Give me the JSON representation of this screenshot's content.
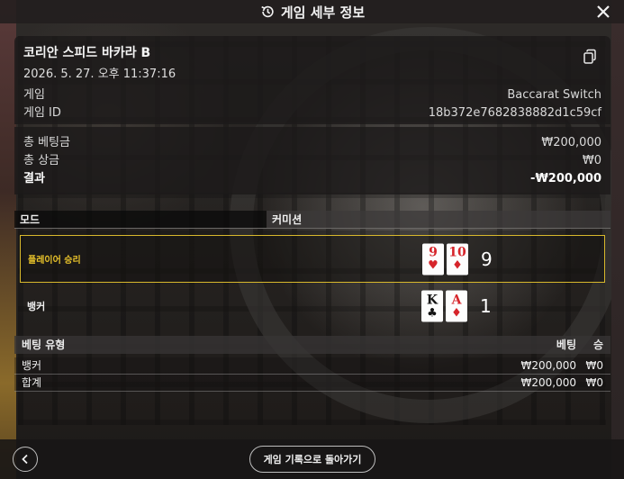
{
  "header": {
    "title": "게임 세부 정보"
  },
  "game": {
    "table_name": "코리안 스피드 바카라 B",
    "datetime": "2026. 5. 27. 오후 11:37:16",
    "game_label": "게임",
    "game_value": "Baccarat Switch",
    "game_id_label": "게임 ID",
    "game_id_value": "18b372e7682838882d1c59cf"
  },
  "totals": {
    "total_bet_label": "총 베팅금",
    "total_bet_value": "₩200,000",
    "total_win_label": "총 상금",
    "total_win_value": "₩0",
    "result_label": "결과",
    "result_value": "-₩200,000"
  },
  "mode": {
    "mode_label": "모드",
    "mode_value": "커미션"
  },
  "outcomes": {
    "player": {
      "label": "플레이어 승리",
      "score": "9",
      "cards": [
        {
          "rank": "9",
          "suit": "♥"
        },
        {
          "rank": "10",
          "suit": "♦"
        }
      ]
    },
    "banker": {
      "label": "뱅커",
      "score": "1",
      "cards": [
        {
          "rank": "K",
          "suit": "♣"
        },
        {
          "rank": "A",
          "suit": "♦"
        }
      ]
    }
  },
  "bets": {
    "headers": {
      "type": "베팅 유형",
      "bet": "베팅",
      "win": "승"
    },
    "rows": [
      {
        "type": "뱅커",
        "bet": "₩200,000",
        "win": "₩0"
      },
      {
        "type": "합계",
        "bet": "₩200,000",
        "win": "₩0"
      }
    ]
  },
  "footer": {
    "return_label": "게임 기록으로 돌아가기"
  },
  "colors": {
    "highlight": "#d8b82c",
    "player_label": "#e8c22a",
    "card_red": "#d6242a"
  },
  "icons": {
    "header": "history-icon",
    "close": "close-icon",
    "copy": "copy-icon",
    "back": "chevron-left-icon"
  }
}
